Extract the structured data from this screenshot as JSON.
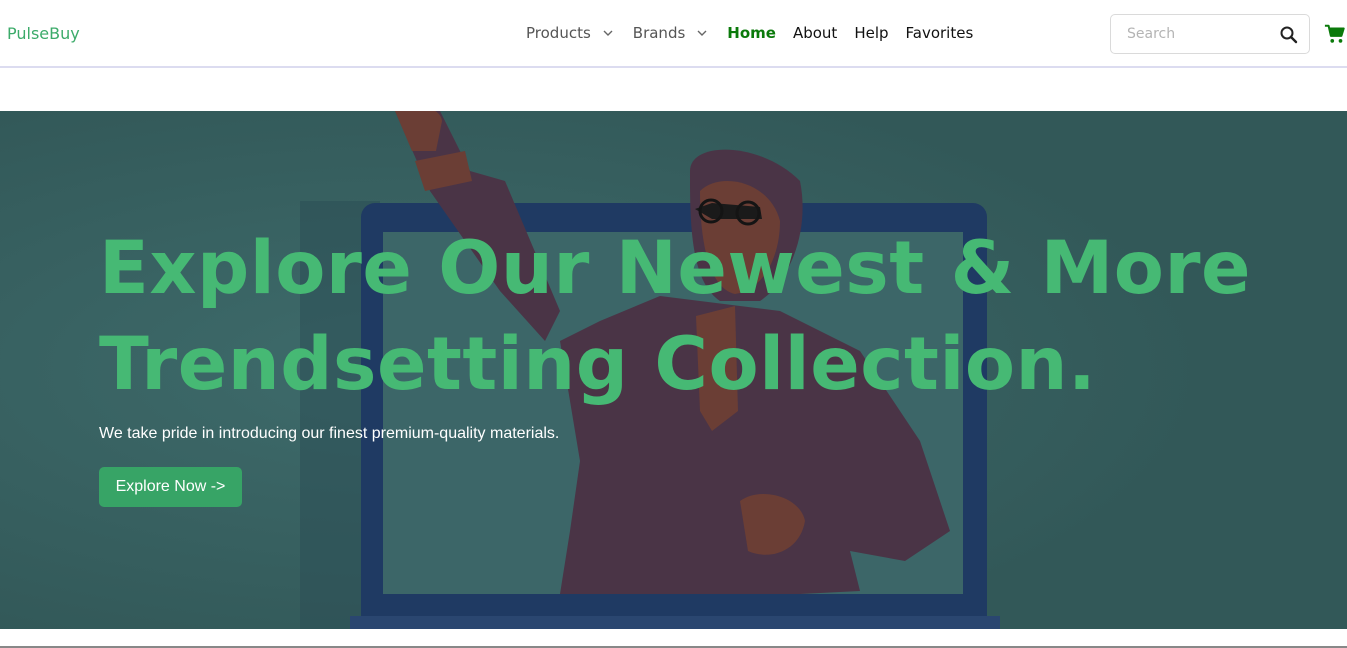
{
  "header": {
    "brand": "PulseBuy",
    "nav": {
      "products": "Products",
      "brands": "Brands",
      "home": "Home",
      "about": "About",
      "help": "Help",
      "favorites": "Favorites"
    },
    "search": {
      "placeholder": "Search",
      "value": ""
    }
  },
  "hero": {
    "title_line1": "Explore Our Newest & More",
    "title_line2": "Trendsetting Collection.",
    "subtitle": "We take pride in introducing our finest premium-quality materials.",
    "cta_label": "Explore Now ->"
  },
  "colors": {
    "brand": "#3cab6a",
    "active_nav": "#0b7a0b",
    "hero_overlay": "#386161",
    "hero_title": "#46b974",
    "cta_bg": "#37a466",
    "cart_icon": "#0b7a0b"
  },
  "icons": {
    "products_caret": "chevron-down-icon",
    "brands_caret": "chevron-down-icon",
    "search": "search-icon",
    "cart": "cart-icon"
  }
}
